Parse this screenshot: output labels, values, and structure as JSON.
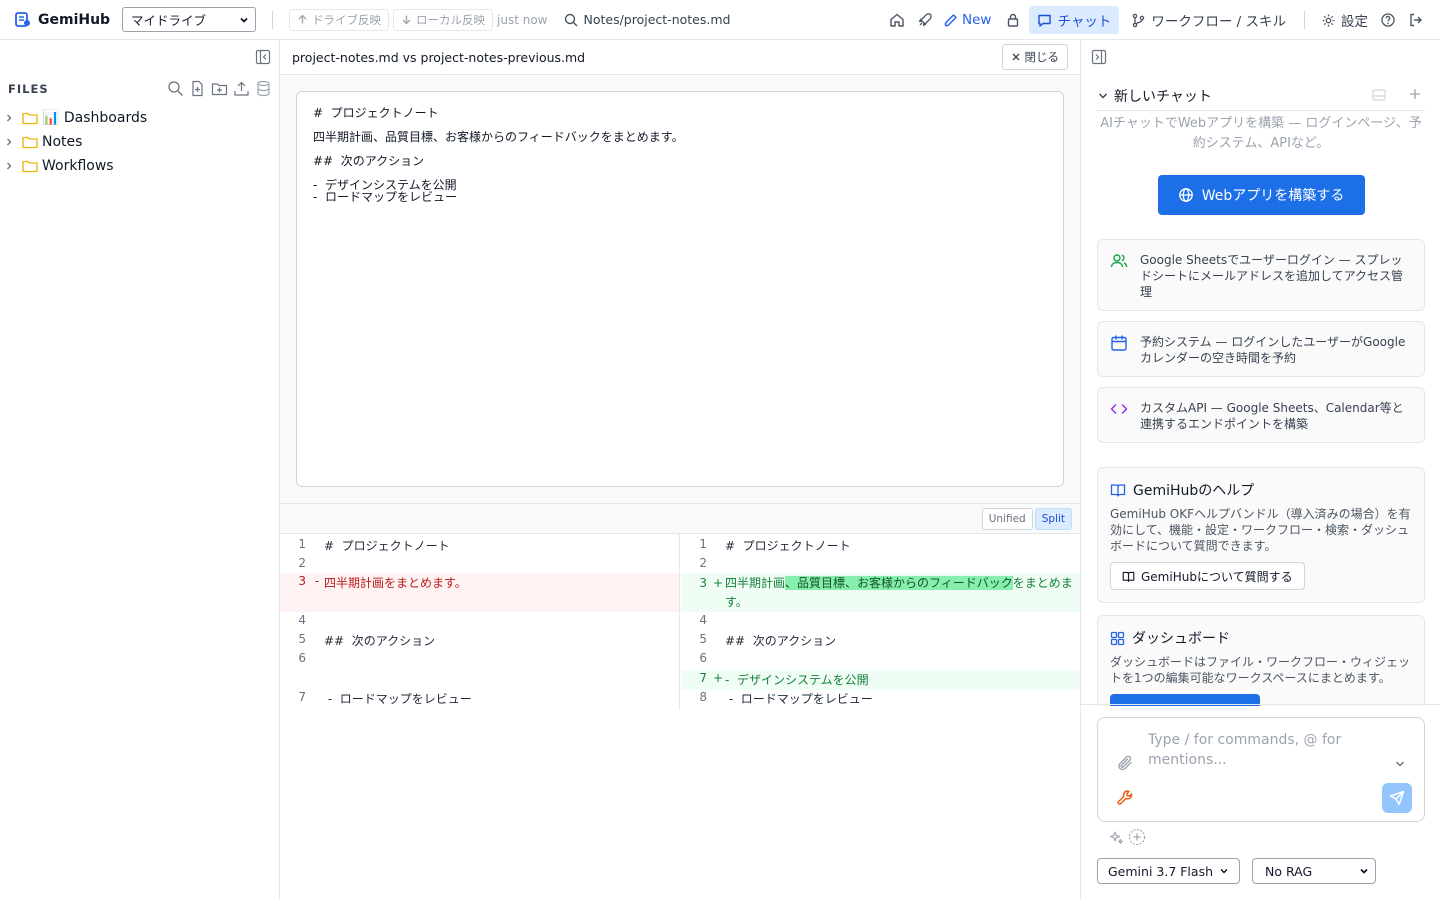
{
  "app": {
    "name": "GemiHub"
  },
  "topbar": {
    "drive_select": "マイドライブ",
    "push_label": "ドライブ反映",
    "pull_label": "ローカル反映",
    "sync_time": "just now",
    "file_path": "Notes/project-notes.md",
    "new_label": "New",
    "chat_label": "チャット",
    "workflow_label": "ワークフロー / スキル",
    "settings_label": "設定"
  },
  "sidebar": {
    "title": "FILES",
    "items": [
      {
        "label": "📊 Dashboards"
      },
      {
        "label": "Notes"
      },
      {
        "label": "Workflows"
      }
    ]
  },
  "diff": {
    "title": "project-notes.md vs project-notes-previous.md",
    "close_label": "閉じる",
    "editor_lines": [
      "#  プロジェクトノート",
      "四半期計画、品質目標、お客様からのフィードバックをまとめます。",
      "##  次のアクション",
      "-  デザインシステムを公開",
      "-  ロードマップをレビュー"
    ],
    "mode_unified": "Unified",
    "mode_split": "Split",
    "left": [
      {
        "num": "1",
        "mark": "",
        "text": "#  プロジェクトノート"
      },
      {
        "num": "2",
        "mark": "",
        "text": ""
      },
      {
        "num": "3",
        "mark": "-",
        "text": "四半期計画をまとめます。"
      },
      {
        "num": "4",
        "mark": "",
        "text": ""
      },
      {
        "num": "5",
        "mark": "",
        "text": "##  次のアクション"
      },
      {
        "num": "6",
        "mark": "",
        "text": ""
      },
      {
        "num": "7",
        "mark": "",
        "text": " -  ロードマップをレビュー"
      }
    ],
    "right": [
      {
        "num": "1",
        "mark": "",
        "text": "#  プロジェクトノート"
      },
      {
        "num": "2",
        "mark": "",
        "text": ""
      },
      {
        "num": "3",
        "mark": "+",
        "text_pre": "四半期計画",
        "text_hl": "、品質目標、お客様からのフィードバック",
        "text_post": "をまとめます。"
      },
      {
        "num": "4",
        "mark": "",
        "text": ""
      },
      {
        "num": "5",
        "mark": "",
        "text": "##  次のアクション"
      },
      {
        "num": "6",
        "mark": "",
        "text": ""
      },
      {
        "num": "7",
        "mark": "+",
        "text": "-  デザインシステムを公開"
      },
      {
        "num": "8",
        "mark": "",
        "text": " -  ロードマップをレビュー"
      }
    ]
  },
  "chat": {
    "header": "新しいチャット",
    "intro": "AIチャットでWebアプリを構築 — ログインページ、予約システム、APIなど。",
    "build_button": "Webアプリを構築する",
    "suggestions": [
      {
        "icon": "users-icon",
        "text": "Google Sheetsでユーザーログイン — スプレッドシートにメールアドレスを追加してアクセス管理"
      },
      {
        "icon": "calendar-icon",
        "text": "予約システム — ログインしたユーザーがGoogleカレンダーの空き時間を予約"
      },
      {
        "icon": "code-icon",
        "text": "カスタムAPI — Google Sheets、Calendar等と連携するエンドポイントを構築"
      }
    ],
    "help": {
      "title": "GemiHubのヘルプ",
      "desc": "GemiHub OKFヘルプバンドル（導入済みの場合）を有効にして、機能・設定・ワークフロー・検索・ダッシュボードについて質問できます。",
      "button": "GemiHubについて質問する"
    },
    "dashboard": {
      "title": "ダッシュボード",
      "desc": "ダッシュボードはファイル・ワークフロー・ウィジェットを1つの編集可能なワークスペースにまとめます。"
    },
    "composer_placeholder": "Type / for commands, @ for mentions...",
    "model": "Gemini 3.7 Flash",
    "rag": "No RAG"
  },
  "colors": {
    "accent": "#1d6fe8",
    "chat_tab_bg": "#dbeafe",
    "deleted_bg": "#fef2f2",
    "added_bg": "#f0fdf4",
    "added_highlight": "#86efac"
  }
}
